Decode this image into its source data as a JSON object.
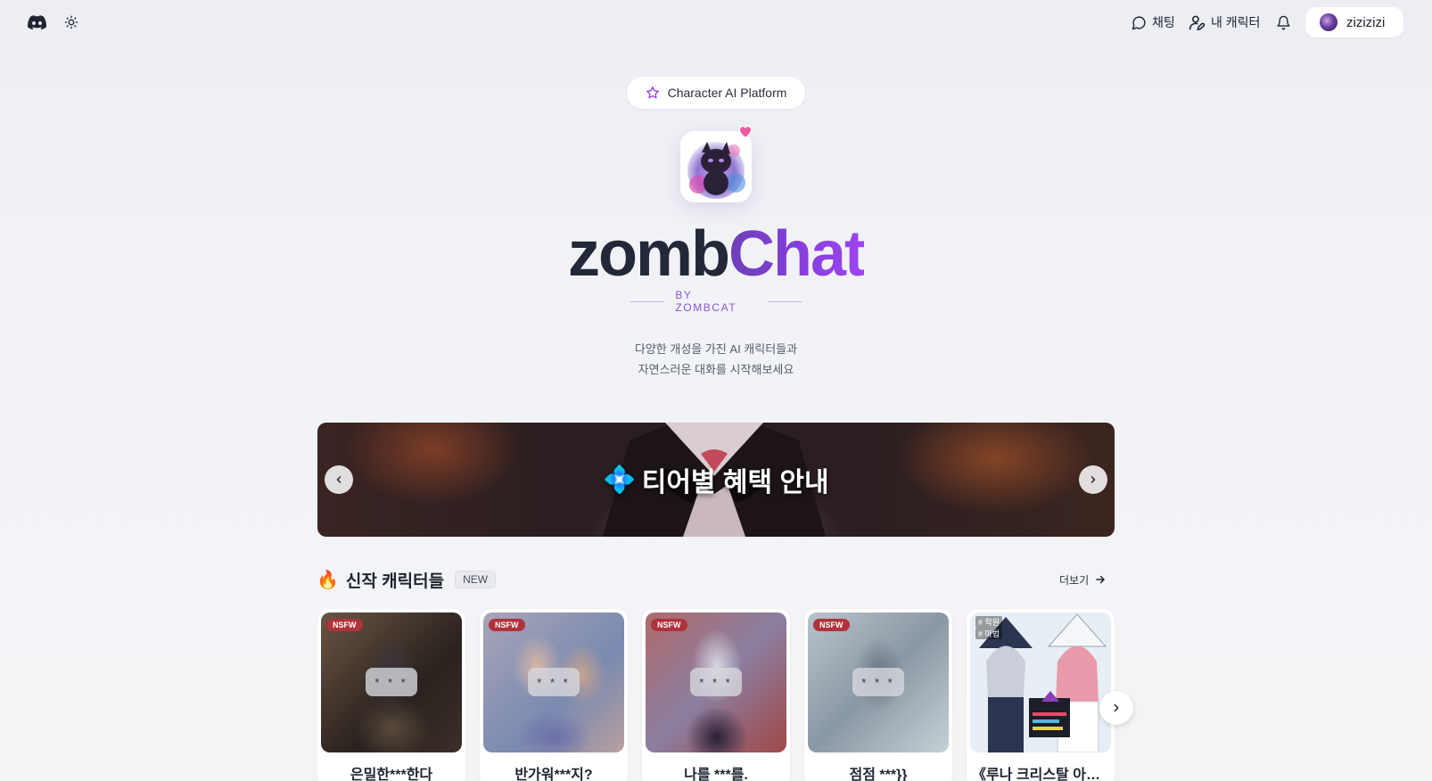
{
  "header": {
    "chat_label": "채팅",
    "my_character_label": "내 캐릭터",
    "username": "zizizizi"
  },
  "hero": {
    "platform_label": "Character AI Platform",
    "brand_part1": "zomb",
    "brand_part2": "Chat",
    "byline": "BY ZOMBCAT",
    "tagline_line1": "다양한 개성을 가진 AI 캐릭터들과",
    "tagline_line2": "자연스러운 대화를 시작해보세요"
  },
  "banner": {
    "title": "티어별 혜택 안내",
    "emoji": "💠"
  },
  "new_section": {
    "emoji": "🔥",
    "title": "신작 캐릭터들",
    "badge": "NEW",
    "more_label": "더보기",
    "cards": [
      {
        "name": "은밀한***한다",
        "nsfw": "NSFW",
        "mask": "* * *"
      },
      {
        "name": "반가워***지?",
        "nsfw": "NSFW",
        "mask": "* * *"
      },
      {
        "name": "나를 ***를.",
        "nsfw": "NSFW",
        "mask": "* * *"
      },
      {
        "name": "점점 ***}}",
        "nsfw": "NSFW",
        "mask": "* * *"
      },
      {
        "name": "《루나 크리스탈 아카데미》",
        "tags": [
          "# 학원",
          "# 마법"
        ]
      }
    ]
  },
  "colors": {
    "accent": "#8a3fe0",
    "nsfw": "#b0323a",
    "background": "#f1f2f6"
  }
}
